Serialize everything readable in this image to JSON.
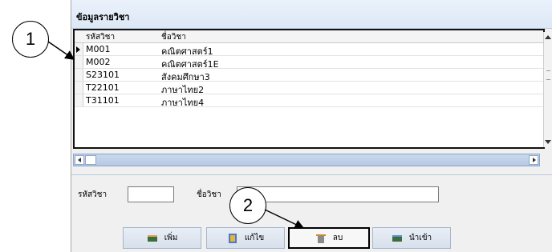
{
  "panel": {
    "title": "ข้อมูลรายวิชา"
  },
  "grid": {
    "columns": [
      "รหัสวิชา",
      "ชื่อวิชา"
    ],
    "rows": [
      {
        "code": "M001",
        "name": "คณิตศาสตร์1"
      },
      {
        "code": "M002",
        "name": "คณิตศาสตร์1E"
      },
      {
        "code": "S23101",
        "name": "สังคมศึกษา3"
      },
      {
        "code": "T22101",
        "name": "ภาษาไทย2"
      },
      {
        "code": "T31101",
        "name": "ภาษาไทย4"
      }
    ],
    "selected_row": 0
  },
  "form": {
    "code_label": "รหัสวิชา",
    "code_value": "",
    "name_label": "ชื่อวิชา",
    "name_value": ""
  },
  "buttons": {
    "add": "เพิ่ม",
    "edit": "แก้ไข",
    "delete": "ลบ",
    "import": "นำเข้า"
  },
  "callouts": {
    "one": "1",
    "two": "2"
  },
  "icons": {
    "add": "book-add-icon",
    "edit": "edit-form-icon",
    "delete": "delete-bin-icon",
    "import": "book-import-icon"
  }
}
